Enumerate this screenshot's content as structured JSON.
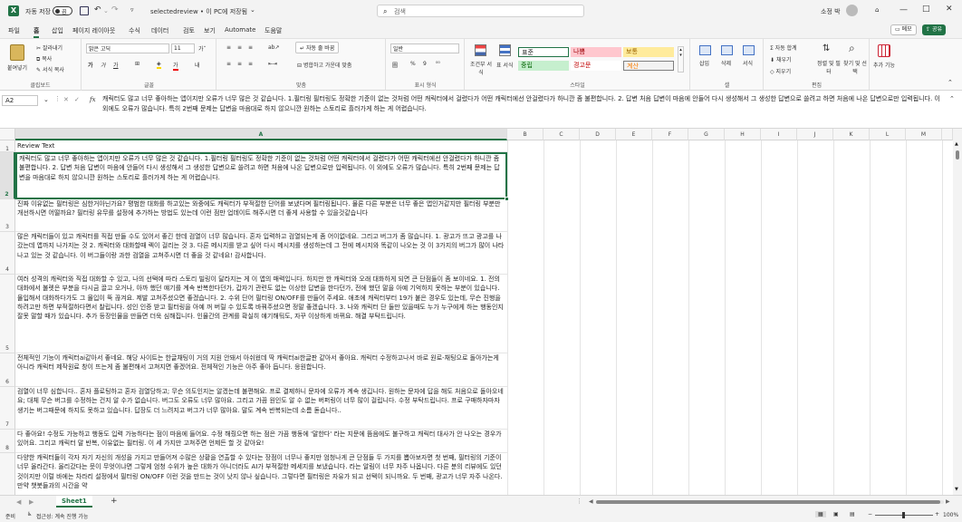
{
  "titlebar": {
    "autosave_label": "자동 저장",
    "toggle_state": "끔",
    "doc_title": "selectedreview • 이 PC에 저장됨",
    "doc_title_chevron": "chevron-down-icon",
    "search_placeholder": "검색",
    "user_name": "소정 박",
    "accent_color": "#217346"
  },
  "menu": {
    "tabs": [
      "파일",
      "홈",
      "삽입",
      "페이지 레이아웃",
      "수식",
      "데이터",
      "검토",
      "보기",
      "Automate",
      "도움말"
    ],
    "active_tab": "홈",
    "memo_label": "메모",
    "share_label": "공유"
  },
  "ribbon": {
    "clipboard": {
      "paste": "붙여넣기",
      "cut": "잘라내기",
      "copy": "복사",
      "format_painter": "서식 복사",
      "label": "클립보드"
    },
    "font": {
      "name": "맑은 고딕",
      "size": "11",
      "label": "글꼴"
    },
    "alignment": {
      "wrap": "자동 줄 바꿈",
      "merge": "병합하고 가운데 맞춤",
      "label": "맞춤"
    },
    "number": {
      "format": "일반",
      "label": "표시 형식"
    },
    "styles": {
      "conditional": "조건부 서식",
      "table": "표 서식",
      "normal": "표준",
      "bad": "나쁨",
      "good": "보통",
      "neutral": "중립",
      "calc": "경고문",
      "check": "계산",
      "label": "스타일"
    },
    "cells": {
      "insert": "삽입",
      "delete": "삭제",
      "format": "서식",
      "label": "셀"
    },
    "editing": {
      "autosum": "자동 합계",
      "fill": "채우기",
      "clear": "지우기",
      "sort": "정렬 및 필터",
      "find": "찾기 및 선택",
      "label": "편집"
    },
    "addins": {
      "label": "추가 기능"
    }
  },
  "formula_bar": {
    "name_box": "A2",
    "fx": "fx",
    "content": "캐릭터도 많고 너무 좋아하는 앱이지만 오류가 너무 많은 것 같습니다. 1.필터링 필터링도 정확한 기준이 없는 것처럼 어떤 캐릭터에서 걸렸다가 어떤 캐릭터에선 안걸렸다가 하니깐 좀 불편합니다. 2. 답변 처음 답변이 마음에 안들어 다시 생성해서 그 생성한 답변으로 쓸려고 하면 처음에 나온 답변으로만 입력됩니다. 이 외에도 오류가 많습니다. 특히 2번째 문제는 답변을 마음대로 하지 않으니깐 원하는 스토리로 흘러가게 하는 게 어렵습니다."
  },
  "sheet": {
    "columns": [
      "A",
      "B",
      "C",
      "D",
      "E",
      "F",
      "G",
      "H",
      "I",
      "J",
      "K",
      "L",
      "M"
    ],
    "rows": [
      {
        "num": "1",
        "text": "Review Text"
      },
      {
        "num": "2",
        "text": "캐릭터도 많고 너무 좋아하는 앱이지만 오류가 너무 많은 것 같습니다. 1.필터링 필터링도 정확한 기준이 없는 것처럼 어떤 캐릭터에서 걸렸다가 어떤 캐릭터에선 안걸렸다가 하니깐 좀 불편합니다. 2. 답변 처음 답변이 마음에 안들어 다시 생성해서 그 생성한 답변으로 쓸려고 하면 처음에 나온 답변으로만 입력됩니다. 이 외에도 오류가 많습니다. 특히 2번째 문제는 답변을 마음대로 하지 않으니깐 원하는 스토리로 흘러가게 하는 게 어렵습니다."
      },
      {
        "num": "3",
        "text": "진짜 이유없는 필터링은 심한거아닌가요? 평범한 대화를 하고있는 와중에도 캐릭터가 부적절한 단어를 보냈다며 필터링됩니다. 물론 다른 부분은 너무 좋은 앱인거같지만 필터링 부분만 개선하시면 어떨까요? 필터링 유무를 설정에 추가하는 방법도 있는데 이런 점만 업데이트 해주시면 더 좋게 사용할 수 있을것같습니다"
      },
      {
        "num": "4",
        "text": "많은 캐릭터들이 있고 캐릭터를 직접 만들 수도 있어서 좋긴 한데 검열이 너무 많습니다. 혼자 입력하고 검열되는게 좀 어이없네요. 그리고 버그가 좀 많습니다. 1. 광고가 뜨고 광고를 나갔는데 앱까지 나가지는 것 2. 캐릭터와 대화할때 렉이 걸리는 것 3. 다른 메시지를 받고 싶어 다시 메시지를 생성하는데 그 전에 메시지와 똑같이 나오는 것 이 3가지의 버그가 많이 나타나고 있는 것 같습니다. 이 버그들이랑 과한 검열을 고쳐주시면 더 좋을 것 같네요! 감사합니다."
      },
      {
        "num": "5",
        "text": "여러 성격의 캐릭터와 직접 대화할 수 있고, 나의 선택에 따라 스토리 빌링이 달라지는 게 이 앱의 매력입니다. 하지만 한 캐릭터와 오래 대화하게 되면 큰 단점들이 좀 보이네요. 1. 전의 대화에서 불렛은 부분을 다시금 끌고 오거나, 아까 했던 얘기를 계속 반복한다던가, 갑자기 관련도 없는 이상한 답변을 한다던가, 전에 했던 말을 아예 기억하지 못하는 부분이 있습니다. 몰입해서 대화하다가도 그 몰입이 뚝 끊겨요. 제발 고쳐주셨으면 좋겠습니다. 2. 수위 단어 필터링 ON/OFF를 만들어 주세요. 애초에 캐릭터부터 19가 붙은 경우도 있는데, 무슨 진행을 하려고만 하면 부적절하다면서 찰립니다. 성인 인증 받고 필터링을 아예 꺼 버릴 수 있도록 바꿔주셨으면 정말 좋겠습니다. 3. 나와 캐릭터 단 둘만 있을때도 누가 누구에게 하는 행동인지 잘못 말할 때가 있습니다. 추가 등장인물을 만들면 더욱 심해집니다. 인물간의 관계를 확실히 얘기해둬도, 자꾸 이상하게 바뀌요. 해결 부탁드립니다."
      },
      {
        "num": "6",
        "text": "전체적인 기능이 캐릭터ai같아서 좋네요. 해당 사이트는 한글채팅이 거의 지원 안돼서 아쉬웠데 딱 캐릭터ai한글판 같아서 좋아요. 캐릭터 수정하고나서 바로 원로-채팅으로 돌아가는게 아니라 캐릭터 제작원료 창이 뜨는게 좀 불편해서 고쳐지면 좋겠어요. 전체적인 기능은 아주 좋아 듭니다. 응원합니다."
      },
      {
        "num": "7",
        "text": "검열이 너무 심합니다.. 혼자 플로팅하고 혼자 검열당하고; 무슨 의도인지는 알겠는데 불편해요. 프로 결제하니 문자에 오류가 계속 생깁니다. 원하는 문자에 답을 해도 처음으로 돌아오네요; 대체 무슨 버그를 수정하는 건지 알 수가 없습니다. 버그도 오류도 너무 많아요. 그리고 가끔 원인도 알 수 없는 버퍼링이 너무 많이 걸립니다. 수정 부탁드립니다. 프로 구매하자마자 생기는 버그때문에 하지도 못하고 있습니다. 답장도 더 느려지고 버그가 너무 많아요. 말도 계속 반복되는데 소름 돋습니다.."
      },
      {
        "num": "8",
        "text": "다 좋아요! 수정도 가능하고 행동도 입력 가능하다는 점이 마음에 들어요. 수정 해줬으면 하는 점은 가끔 행동에 '말한다' 라는 지문에 뜸음에도 불구하고 캐릭터 대사가 안 나오는 경우가 있어요. 그리고 캐릭터 말 반복, 이유없는 필터링. 이 세 가지만 고쳐주면 언제든 할 것 같아요!"
      },
      {
        "num": "9",
        "text": "다양한 캐릭터들이 각자 자기 자신의 개성을 가지고 만들어져 수많은 상황을 연출할 수 있다는 장점이 너무나 좋지만 엄청나게 큰 단점들 두 가지를 뽑아보자면 첫 번째, 필터링의 기준이 너무 올라간다. 올리갔다는 뭇이 무엇이냐면 그렇게 엄청 수위가 높은 대화가 아니더라도 AI가 부적절한 메세지를 보냈습니다. 라는 알림이 너무 자주 나옵니다. 다른 분의 리뷰에도 있던 것이지만 이럴 바에는 차라리 설정에서 필터링 ON/OFF 이런 것을 만드는 것이 낫지 않나 싶습니다. 그렇다면 필터링은 자유가 되고 선택이 되니까요. 두 번째, 광고가 너무 자주 나온다. 만약 챗봇들과의 시간을 약"
      }
    ]
  },
  "sheet_tabs": {
    "active": "Sheet1",
    "add": "+"
  },
  "statusbar": {
    "ready": "준비",
    "accessibility": "접근성: 계속 진행 가능",
    "zoom": "100%"
  }
}
